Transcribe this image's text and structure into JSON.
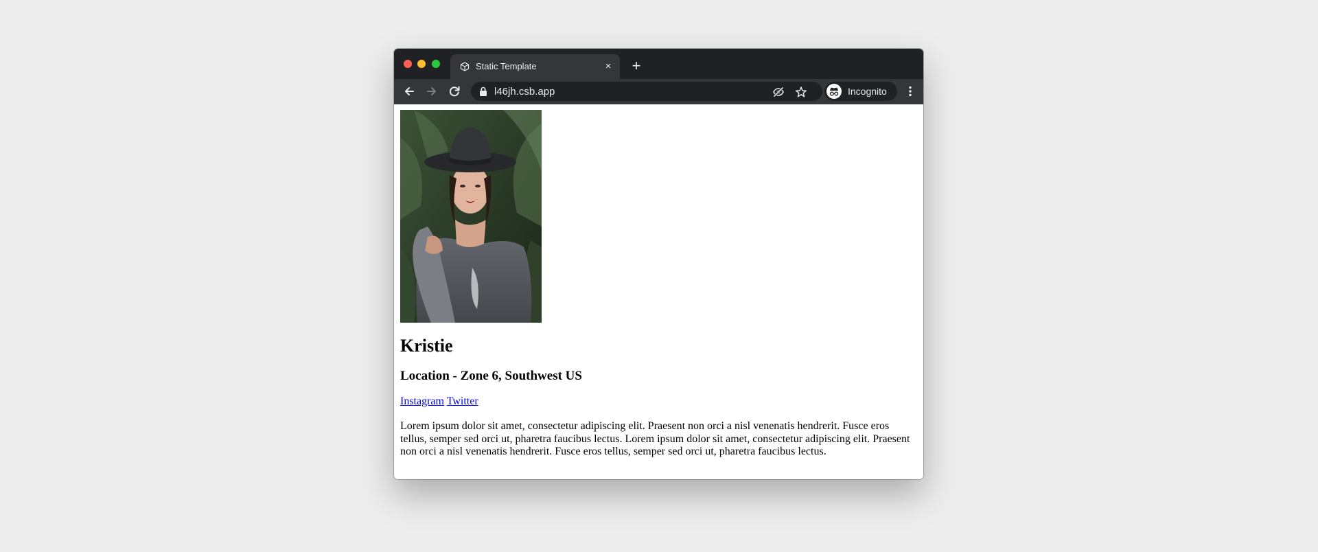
{
  "browser": {
    "tab": {
      "title": "Static Template",
      "favicon": "codesandbox-cube-icon",
      "close": "×"
    },
    "new_tab": "+",
    "address_bar": {
      "url": "l46jh.csb.app",
      "lock": "lock-icon"
    },
    "icons": [
      "back-arrow-icon",
      "forward-arrow-icon",
      "reload-icon",
      "eye-off-icon",
      "star-icon",
      "incognito-icon",
      "kebab-menu-icon"
    ],
    "profile": {
      "label": "Incognito"
    }
  },
  "page": {
    "photo": {
      "icon": "profile-photo"
    },
    "name": "Kristie",
    "location": "Location - Zone 6, Southwest US",
    "links": {
      "instagram": "Instagram",
      "twitter": "Twitter"
    },
    "bio": "Lorem ipsum dolor sit amet, consectetur adipiscing elit. Praesent non orci a nisl venenatis hendrerit. Fusce eros tellus, semper sed orci ut, pharetra faucibus lectus. Lorem ipsum dolor sit amet, consectetur adipiscing elit. Praesent non orci a nisl venenatis hendrerit. Fusce eros tellus, semper sed orci ut, pharetra faucibus lectus."
  },
  "colors": {
    "desktop": "#ededed",
    "tabstrip": "#202124",
    "toolbar": "#35363a",
    "link": "#0000ee"
  }
}
